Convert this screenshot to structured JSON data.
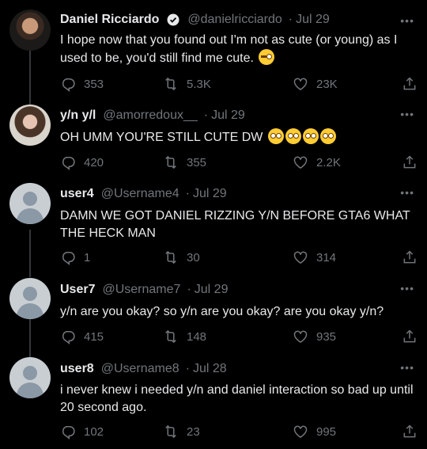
{
  "tweets": [
    {
      "name": "Daniel Ricciardo",
      "verified": true,
      "handle": "@danielricciardo",
      "date": "Jul 29",
      "text": "I hope now that you found out I'm not as cute (or young) as I used to be, you'd still find me cute.",
      "emoji": "winking-face",
      "replies": "353",
      "retweets": "5.3K",
      "likes": "23K"
    },
    {
      "name": "y/n y/l",
      "handle": "@amorredoux__",
      "date": "Jul 29",
      "text": "OH UMM YOU'RE STILL CUTE DW",
      "emoji": "flushed-face x4",
      "replies": "420",
      "retweets": "355",
      "likes": "2.2K"
    },
    {
      "name": "user4",
      "handle": "@Username4",
      "date": "Jul 29",
      "text": "DAMN WE GOT DANIEL RIZZING Y/N BEFORE GTA6 WHAT THE HECK MAN",
      "replies": "1",
      "retweets": "30",
      "likes": "314"
    },
    {
      "name": "User7",
      "handle": "@Username7",
      "date": "Jul 29",
      "text": "y/n are you okay? so y/n are you okay? are you okay y/n?",
      "replies": "415",
      "retweets": "148",
      "likes": "935"
    },
    {
      "name": "user8",
      "handle": "@Username8",
      "date": "Jul 28",
      "text": "i never knew i needed y/n and daniel interaction so bad up until 20 second ago.",
      "replies": "102",
      "retweets": "23",
      "likes": "995"
    }
  ],
  "ui": {
    "dot": "·",
    "more": "•••",
    "accent": "#1d9bf0",
    "muted": "#71767b",
    "background": "#000000"
  }
}
